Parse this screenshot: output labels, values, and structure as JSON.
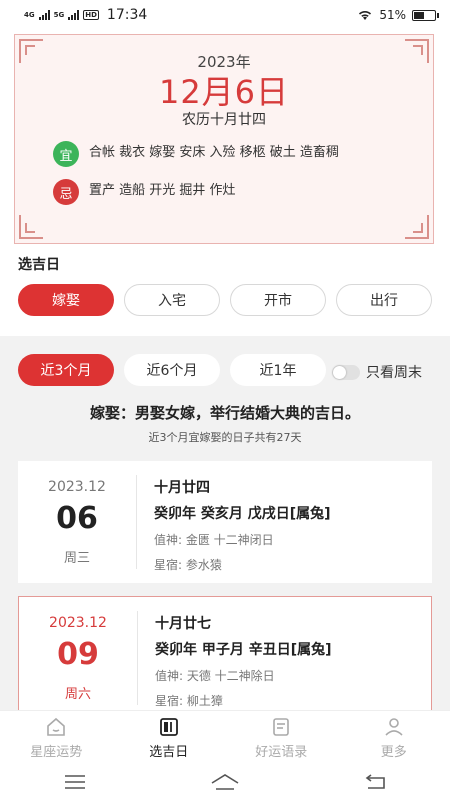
{
  "status_bar": {
    "net1": "4G",
    "net2": "5G",
    "hd": "HD",
    "time": "17:34",
    "battery": "51%",
    "battery_level": 0.51
  },
  "almanac": {
    "year": "2023年",
    "date": "12月6日",
    "lunar": "农历十月廿四",
    "yi_label": "宜",
    "yi_text": "合帐 裁衣 嫁娶 安床 入殓 移柩 破土 造畜稠",
    "ji_label": "忌",
    "ji_text": "置产 造船 开光 掘井 作灶"
  },
  "section_title": "选吉日",
  "categories": [
    "嫁娶",
    "入宅",
    "开市",
    "出行"
  ],
  "ranges": [
    "近3个月",
    "近6个月",
    "近1年"
  ],
  "weekend_toggle": {
    "label": "只看周末",
    "on": false
  },
  "headline": "嫁娶：男娶女嫁，举行结婚大典的吉日。",
  "summary": "近3个月宜嫁娶的日子共有27天",
  "days": [
    {
      "ym": "2023.12",
      "day": "06",
      "week": "周三",
      "lunar": "十月廿四",
      "ganzhi": "癸卯年 癸亥月 戊戌日[属兔]",
      "zhishen": "值神:  金匮    十二神闭日",
      "xingsu": "星宿:  参水猿"
    },
    {
      "ym": "2023.12",
      "day": "09",
      "week": "周六",
      "lunar": "十月廿七",
      "ganzhi": "癸卯年 甲子月 辛丑日[属兔]",
      "zhishen": "值神:  天德    十二神除日",
      "xingsu": "星宿:  柳土獐"
    }
  ],
  "bottom_nav": [
    "星座运势",
    "选吉日",
    "好运语录",
    "更多"
  ],
  "colors": {
    "accent": "#dd3333",
    "yi": "#3cb45a",
    "ji": "#d63b3b"
  }
}
